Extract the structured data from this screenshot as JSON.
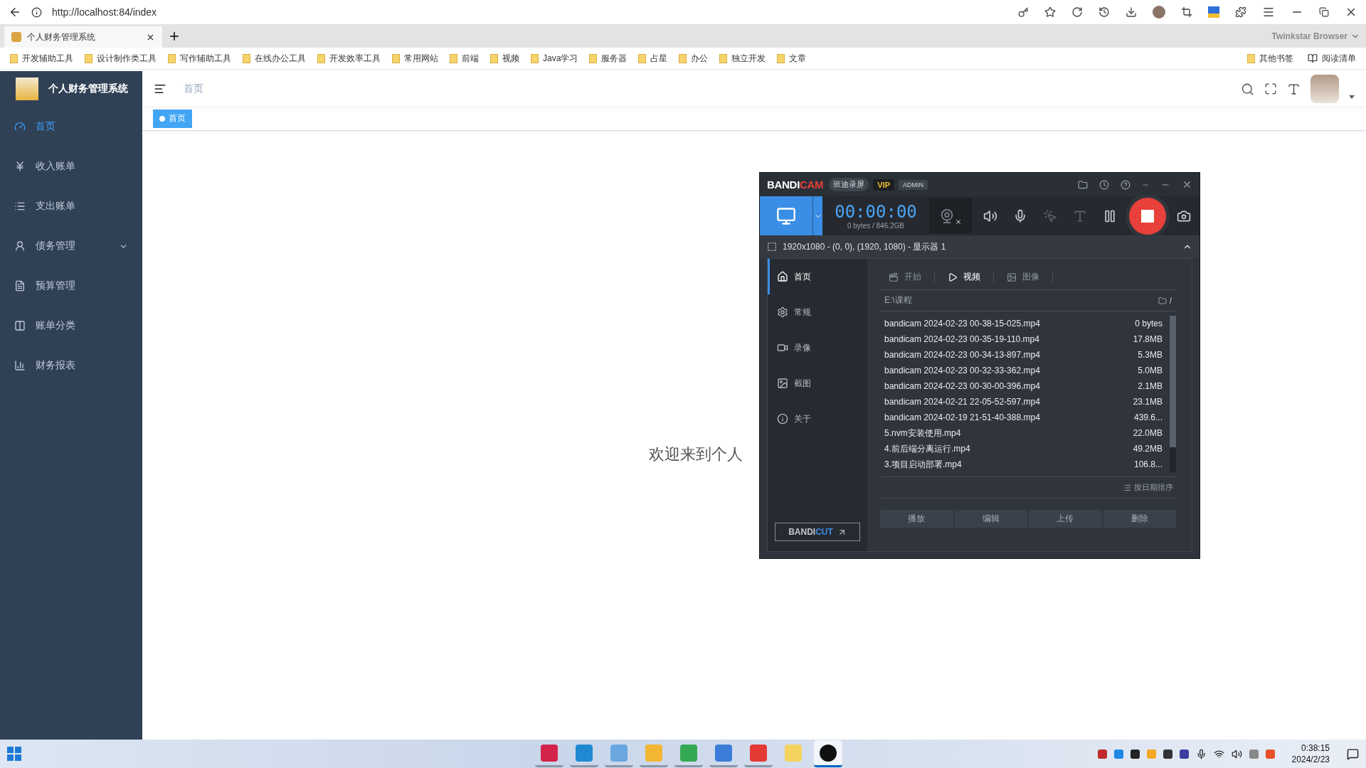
{
  "browser": {
    "url": "http://localhost:84/index",
    "tabs": [
      {
        "title": "个人财务管理系统",
        "selected": true
      }
    ],
    "brand": "Twinkstar Browser",
    "bookmarks": [
      "开发辅助工具",
      "设计制作类工具",
      "写作辅助工具",
      "在线办公工具",
      "开发效率工具",
      "常用网站",
      "前端",
      "视频",
      "Java学习",
      "服务器",
      "占星",
      "办公",
      "独立开发",
      "文章"
    ],
    "other_bookmarks": "其他书签",
    "reading_list": "阅读清单"
  },
  "app": {
    "title": "个人财务管理系统",
    "menu": [
      {
        "label": "首页",
        "selected": true
      },
      {
        "label": "收入账单",
        "selected": false
      },
      {
        "label": "支出账单",
        "selected": false
      },
      {
        "label": "债务管理",
        "selected": false,
        "expanded": false
      },
      {
        "label": "预算管理",
        "selected": false
      },
      {
        "label": "账单分类",
        "selected": false
      },
      {
        "label": "财务报表",
        "selected": false
      }
    ],
    "breadcrumb": "首页",
    "tags": [
      {
        "label": "首页",
        "selected": true
      }
    ],
    "welcome": "欢迎来到个人"
  },
  "recorder": {
    "logo": [
      {
        "text": "BANDI",
        "color": "#ffffff"
      },
      {
        "text": "CAM",
        "color": "#e8403a"
      }
    ],
    "badges": [
      {
        "text": "班迪录屏",
        "kind": "name"
      },
      {
        "text": "VIP",
        "kind": "vip"
      },
      {
        "text": "ADMIN",
        "kind": "admin"
      }
    ],
    "timer": "00:00:00",
    "storage": "0 bytes / 846.2GB",
    "webcam_on": false,
    "area": "1920x1080 - (0, 0), (1920, 1080) - 显示器 1",
    "nav": [
      {
        "label": "首页",
        "selected": true
      },
      {
        "label": "常规",
        "selected": false
      },
      {
        "label": "录像",
        "selected": false
      },
      {
        "label": "截图",
        "selected": false
      },
      {
        "label": "关于",
        "selected": false
      }
    ],
    "bandicut": [
      {
        "text": "BANDI",
        "color": "#c3c8cf"
      },
      {
        "text": "CUT",
        "color": "#3d8de0"
      }
    ],
    "tabs": [
      {
        "label": "开始",
        "selected": false
      },
      {
        "label": "视频",
        "selected": true
      },
      {
        "label": "图像",
        "selected": false
      }
    ],
    "path": "E:\\课程",
    "path_suffix": "/",
    "files": [
      {
        "name": "bandicam 2024-02-23 00-38-15-025.mp4",
        "size": "0 bytes"
      },
      {
        "name": "bandicam 2024-02-23 00-35-19-110.mp4",
        "size": "17.8MB"
      },
      {
        "name": "bandicam 2024-02-23 00-34-13-897.mp4",
        "size": "5.3MB"
      },
      {
        "name": "bandicam 2024-02-23 00-32-33-362.mp4",
        "size": "5.0MB"
      },
      {
        "name": "bandicam 2024-02-23 00-30-00-396.mp4",
        "size": "2.1MB"
      },
      {
        "name": "bandicam 2024-02-21 22-05-52-597.mp4",
        "size": "23.1MB"
      },
      {
        "name": "bandicam 2024-02-19 21-51-40-388.mp4",
        "size": "439.6..."
      },
      {
        "name": "5.nvm安装使用.mp4",
        "size": "22.0MB"
      },
      {
        "name": "4.前后端分离运行.mp4",
        "size": "49.2MB"
      },
      {
        "name": "3.项目启动部署.mp4",
        "size": "106.8..."
      }
    ],
    "sort": "按日期排序",
    "buttons": [
      "播放",
      "编辑",
      "上传",
      "删除"
    ]
  },
  "taskbar": {
    "apps": [
      {
        "running": true,
        "focused": false
      },
      {
        "running": true,
        "focused": false
      },
      {
        "running": true,
        "focused": false
      },
      {
        "running": true,
        "focused": false
      },
      {
        "running": true,
        "focused": false
      },
      {
        "running": true,
        "focused": false
      },
      {
        "running": true,
        "focused": false
      },
      {
        "running": false,
        "focused": false
      },
      {
        "running": true,
        "focused": true
      }
    ],
    "time": "0:38:15",
    "date": "2024/2/23"
  }
}
